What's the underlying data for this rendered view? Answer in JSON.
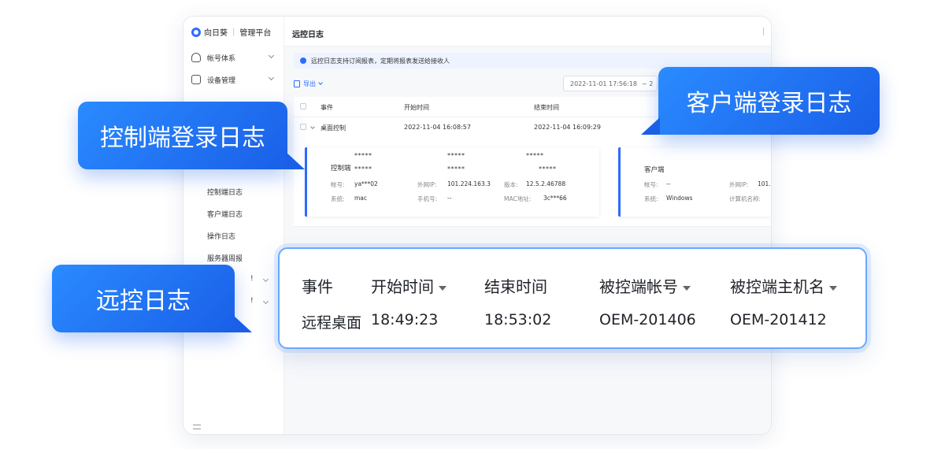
{
  "app": {
    "brand_name": "向日葵",
    "brand_platform": "管理平台"
  },
  "sidebar": {
    "items": [
      {
        "label": "帐号体系"
      },
      {
        "label": "设备管理"
      }
    ],
    "sub_items": [
      {
        "label": "控制端日志"
      },
      {
        "label": "客户端日志"
      },
      {
        "label": "操作日志"
      },
      {
        "label": "服务器周报"
      }
    ],
    "fragment_mark": "!"
  },
  "page": {
    "title": "远控日志",
    "notice": "远控日志支持订阅报表，定期将报表发送给接收人",
    "export_label": "导出",
    "date_range_start": "2022-11-01 17:56:18",
    "date_range_sep": "~ 2"
  },
  "table": {
    "headers": {
      "event": "事件",
      "start": "开始时间",
      "end": "结束时间"
    },
    "row": {
      "event": "桌面控制",
      "start": "2022-11-04 16:08:57",
      "end": "2022-11-04 16:09:29"
    }
  },
  "controller_card": {
    "title": "控制端",
    "masks": [
      "*****",
      "*****",
      "*****",
      "*****",
      "*****",
      "*****"
    ],
    "account_label": "帐号:",
    "account_value": "ya***02",
    "ip_label": "外网IP:",
    "ip_value": "101.224.163.3",
    "version_label": "版本:",
    "version_value": "12.5.2.46788",
    "os_label": "系统:",
    "os_value": "mac",
    "phone_label": "手机号:",
    "phone_value": "--",
    "mac_label": "MAC地址:",
    "mac_value": "3c***66"
  },
  "client_card": {
    "title": "客户端",
    "account_label": "帐号:",
    "account_value": "--",
    "ip_label": "外网IP:",
    "ip_value": "101.",
    "os_label": "系统:",
    "os_value": "Windows",
    "host_label": "计算机名称:"
  },
  "callouts": {
    "controller_log": "控制端登录日志",
    "client_log": "客户端登录日志",
    "remote_log": "远控日志"
  },
  "zoom_table": {
    "headers": {
      "event": "事件",
      "start": "开始时间",
      "end": "结束时间",
      "account": "被控端帐号",
      "host": "被控端主机名"
    },
    "row": {
      "event": "远程桌面",
      "start": "18:49:23",
      "end": "18:53:02",
      "account": "OEM-201406",
      "host": "OEM-201412"
    }
  },
  "colors": {
    "accent": "#2f6bff",
    "bubble_start": "#2a8bff",
    "bubble_end": "#1a5fe8",
    "zoom_border": "#6aa8ff"
  }
}
